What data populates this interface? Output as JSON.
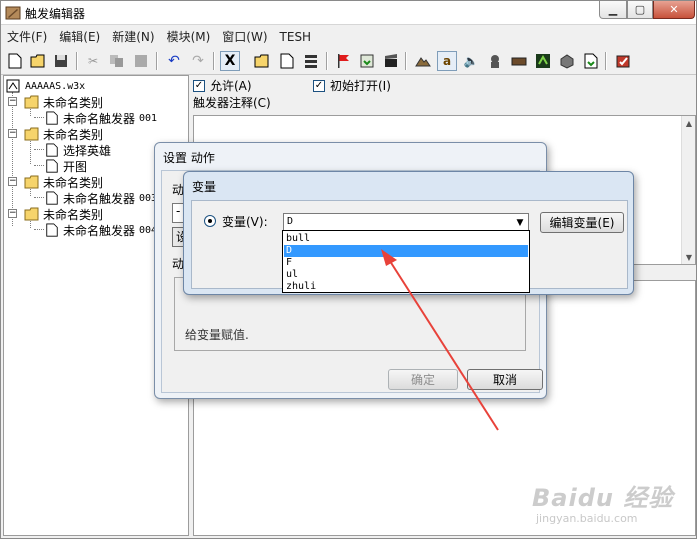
{
  "window": {
    "title": "触发编辑器"
  },
  "menu": [
    "文件(F)",
    "编辑(E)",
    "新建(N)",
    "模块(M)",
    "窗口(W)",
    "TESH"
  ],
  "tree": {
    "root": "AAAAAS.w3x",
    "items": [
      {
        "label": "未命名类别",
        "kind": "folder"
      },
      {
        "label": "未命名触发器",
        "suffix": "001",
        "kind": "trigger"
      },
      {
        "label": "未命名类别",
        "kind": "folder"
      },
      {
        "label": "选择英雄",
        "kind": "trigger"
      },
      {
        "label": "开图",
        "kind": "trigger"
      },
      {
        "label": "未命名类别",
        "kind": "folder"
      },
      {
        "label": "未命名触发器",
        "suffix": "003",
        "kind": "trigger"
      },
      {
        "label": "未命名类别",
        "kind": "folder"
      },
      {
        "label": "未命名触发器",
        "suffix": "004",
        "kind": "trigger"
      }
    ]
  },
  "trigger_panel": {
    "enable_label": "允许(A)",
    "enable_checked": true,
    "initial_label": "初始打开(I)",
    "initial_checked": true,
    "comment_label": "触发器注释(C)"
  },
  "action_dialog": {
    "title": "设置 动作",
    "label_action": "动",
    "field_prefix": "-",
    "label_set": "设",
    "label_action2": "动",
    "desc_prefix": "设",
    "description": "给变量赋值.",
    "ok": "确定",
    "cancel": "取消"
  },
  "variable_dialog": {
    "title": "变量",
    "radio_label": "变量(V):",
    "selected_value": "D",
    "edit_button": "编辑变量(E)",
    "options": [
      "bull",
      "D",
      "F",
      "ul",
      "zhuli"
    ],
    "selected_index": 1
  },
  "behind_cancel": "取消",
  "watermark": {
    "line1": "Baidu 经验",
    "line2": "jingyan.baidu.com"
  }
}
